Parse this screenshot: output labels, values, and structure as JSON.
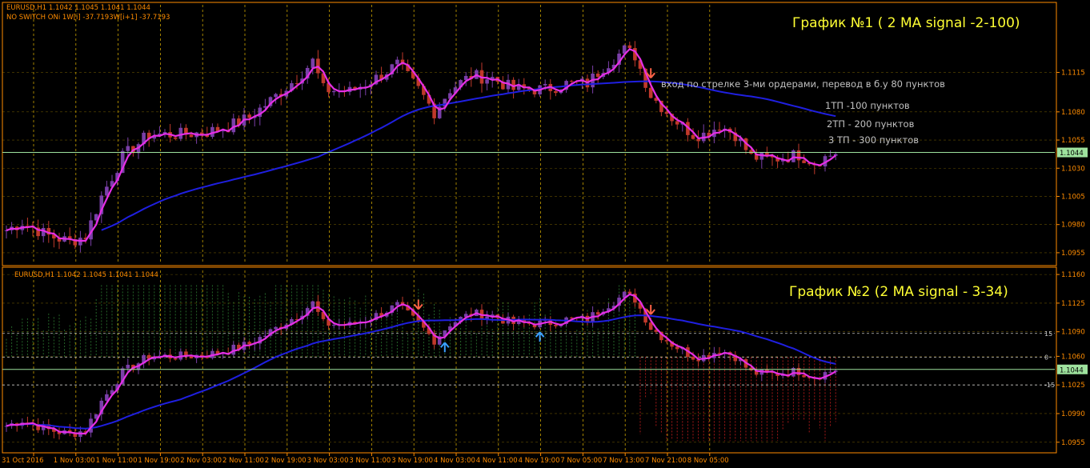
{
  "colors": {
    "background": "#000000",
    "frame": "#ff8c00",
    "grid": "#c8a000",
    "axis_text": "#ff8c00",
    "candle_bull": "#7a3fa8",
    "candle_bear": "#c0392b",
    "fast_ma": "#e62ee6",
    "slow_ma": "#1f1fe0",
    "price_line": "#9ee29e",
    "note_text": "#c0c0c0",
    "title_text": "#ffff33",
    "arrow_down": "#ff6347",
    "arrow_up": "#3aa0ff",
    "hist_pos": "#2e7d32",
    "hist_neg": "#b71c1c",
    "level_line": "#c8c8c8"
  },
  "chart_data": [
    {
      "type": "candlestick",
      "title": "График №1 ( 2 MA signal -2-100)",
      "header": "EURUSD,H1  1.1042 1.1045 1.1041 1.1044",
      "indicator_label": "NO SWITCH ONi 1W[i] -37.7193W[i+1] -37.7193",
      "ylim": [
        1.0945,
        1.1175
      ],
      "y_ticks": [
        "1.1115",
        "1.1080",
        "1.1055",
        "1.1030",
        "1.1005",
        "1.0980",
        "1.0955"
      ],
      "current_price": "1.1044",
      "current_price_value": 1.1044,
      "grid": true,
      "annotations": {
        "entry": "вход по стрелке 3-ми ордерами, перевод в б.у 80 пунктов",
        "tp1": "1ТП -100 пунктов",
        "tp2": "2ТП - 200 пунктов",
        "tp3": "3 ТП - 300 пунктов"
      },
      "signals": [
        {
          "bar": 122,
          "direction": "down"
        }
      ],
      "series": [
        {
          "name": "",
          "role": "fast_ma"
        },
        {
          "name": "",
          "role": "slow_ma"
        }
      ]
    },
    {
      "type": "candlestick",
      "title": "График №2 (2 MA signal - 3-34)",
      "header": "EURUSD,H1  1.1042 1.1045 1.1041 1.1044",
      "ylim": [
        1.0945,
        1.1165
      ],
      "y_ticks": [
        "1.1160",
        "1.1125",
        "1.1090",
        "1.1060",
        "1.1025",
        "1.0990",
        "1.0955"
      ],
      "current_price": "1.1044",
      "current_price_value": 1.1044,
      "level_labels": [
        "15",
        "0",
        "-15"
      ],
      "level_values": [
        1.1088,
        1.1059,
        1.1025
      ],
      "grid": true,
      "signals": [
        {
          "bar": 78,
          "direction": "down"
        },
        {
          "bar": 83,
          "direction": "up"
        },
        {
          "bar": 101,
          "direction": "up"
        },
        {
          "bar": 122,
          "direction": "down"
        }
      ],
      "series": [
        {
          "name": "",
          "role": "fast_ma"
        },
        {
          "name": "",
          "role": "slow_ma"
        }
      ]
    }
  ],
  "x_axis": {
    "labels": [
      "31 Oct 2016",
      "1 Nov 03:00",
      "1 Nov 11:00",
      "1 Nov 19:00",
      "2 Nov 03:00",
      "2 Nov 11:00",
      "2 Nov 19:00",
      "3 Nov 03:00",
      "3 Nov 11:00",
      "3 Nov 19:00",
      "4 Nov 03:00",
      "4 Nov 11:00",
      "4 Nov 19:00",
      "7 Nov 05:00",
      "7 Nov 13:00",
      "7 Nov 21:00",
      "8 Nov 05:00"
    ],
    "bar_count": 158,
    "bars_per_label": 8
  },
  "path_keys": [
    [
      0,
      1.0975
    ],
    [
      3,
      1.0982
    ],
    [
      8,
      1.097
    ],
    [
      12,
      1.0965
    ],
    [
      15,
      1.097
    ],
    [
      18,
      1.1005
    ],
    [
      22,
      1.104
    ],
    [
      27,
      1.106
    ],
    [
      33,
      1.106
    ],
    [
      38,
      1.1062
    ],
    [
      42,
      1.1067
    ],
    [
      46,
      1.1075
    ],
    [
      50,
      1.109
    ],
    [
      55,
      1.111
    ],
    [
      58,
      1.1125
    ],
    [
      60,
      1.11
    ],
    [
      65,
      1.1098
    ],
    [
      70,
      1.111
    ],
    [
      74,
      1.1122
    ],
    [
      78,
      1.11
    ],
    [
      81,
      1.108
    ],
    [
      84,
      1.11
    ],
    [
      88,
      1.1112
    ],
    [
      92,
      1.111
    ],
    [
      96,
      1.11
    ],
    [
      102,
      1.11
    ],
    [
      106,
      1.1105
    ],
    [
      110,
      1.1105
    ],
    [
      113,
      1.112
    ],
    [
      117,
      1.1135
    ],
    [
      119,
      1.113
    ],
    [
      122,
      1.1095
    ],
    [
      126,
      1.1075
    ],
    [
      130,
      1.106
    ],
    [
      132,
      1.106
    ],
    [
      135,
      1.1068
    ],
    [
      138,
      1.106
    ],
    [
      141,
      1.104
    ],
    [
      145,
      1.1038
    ],
    [
      150,
      1.1042
    ],
    [
      153,
      1.1035
    ],
    [
      157,
      1.1044
    ]
  ]
}
